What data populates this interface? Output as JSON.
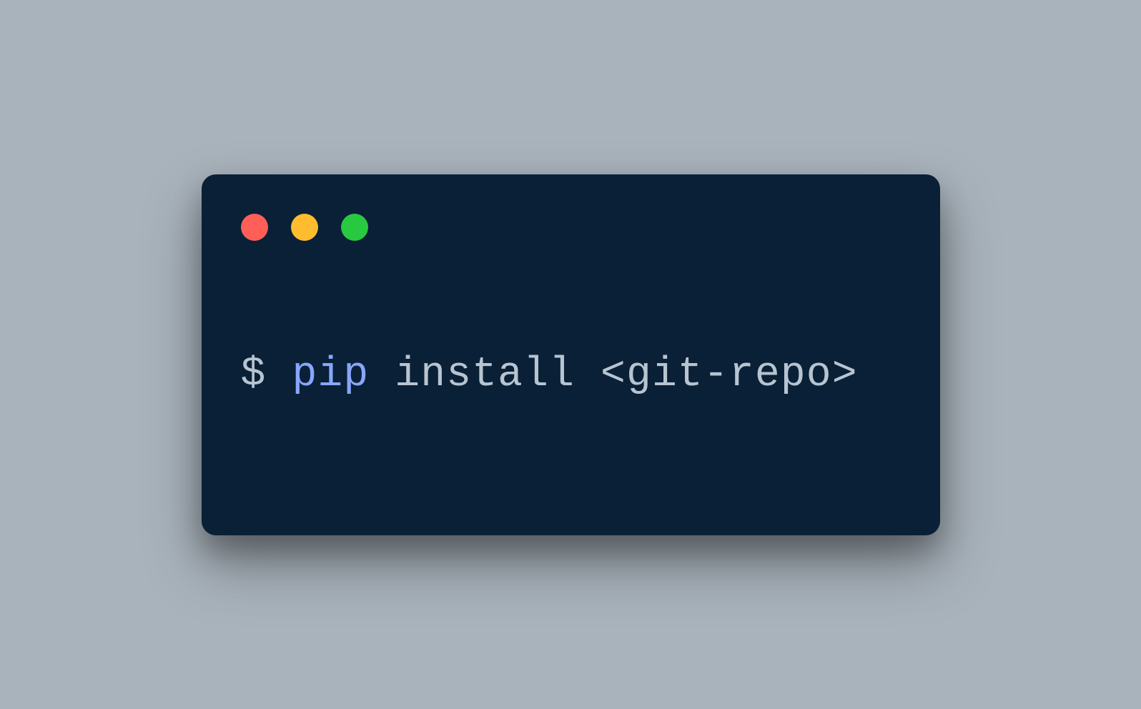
{
  "colors": {
    "red": "#ff5f57",
    "yellow": "#febc2e",
    "green": "#28c840",
    "terminal_bg": "#0a2036",
    "page_bg": "#a9b3bc",
    "prompt_text": "#b7c4d1",
    "command_text": "#88a6ff"
  },
  "terminal": {
    "prompt": "$ ",
    "command": "pip",
    "args": " install <git-repo>"
  }
}
